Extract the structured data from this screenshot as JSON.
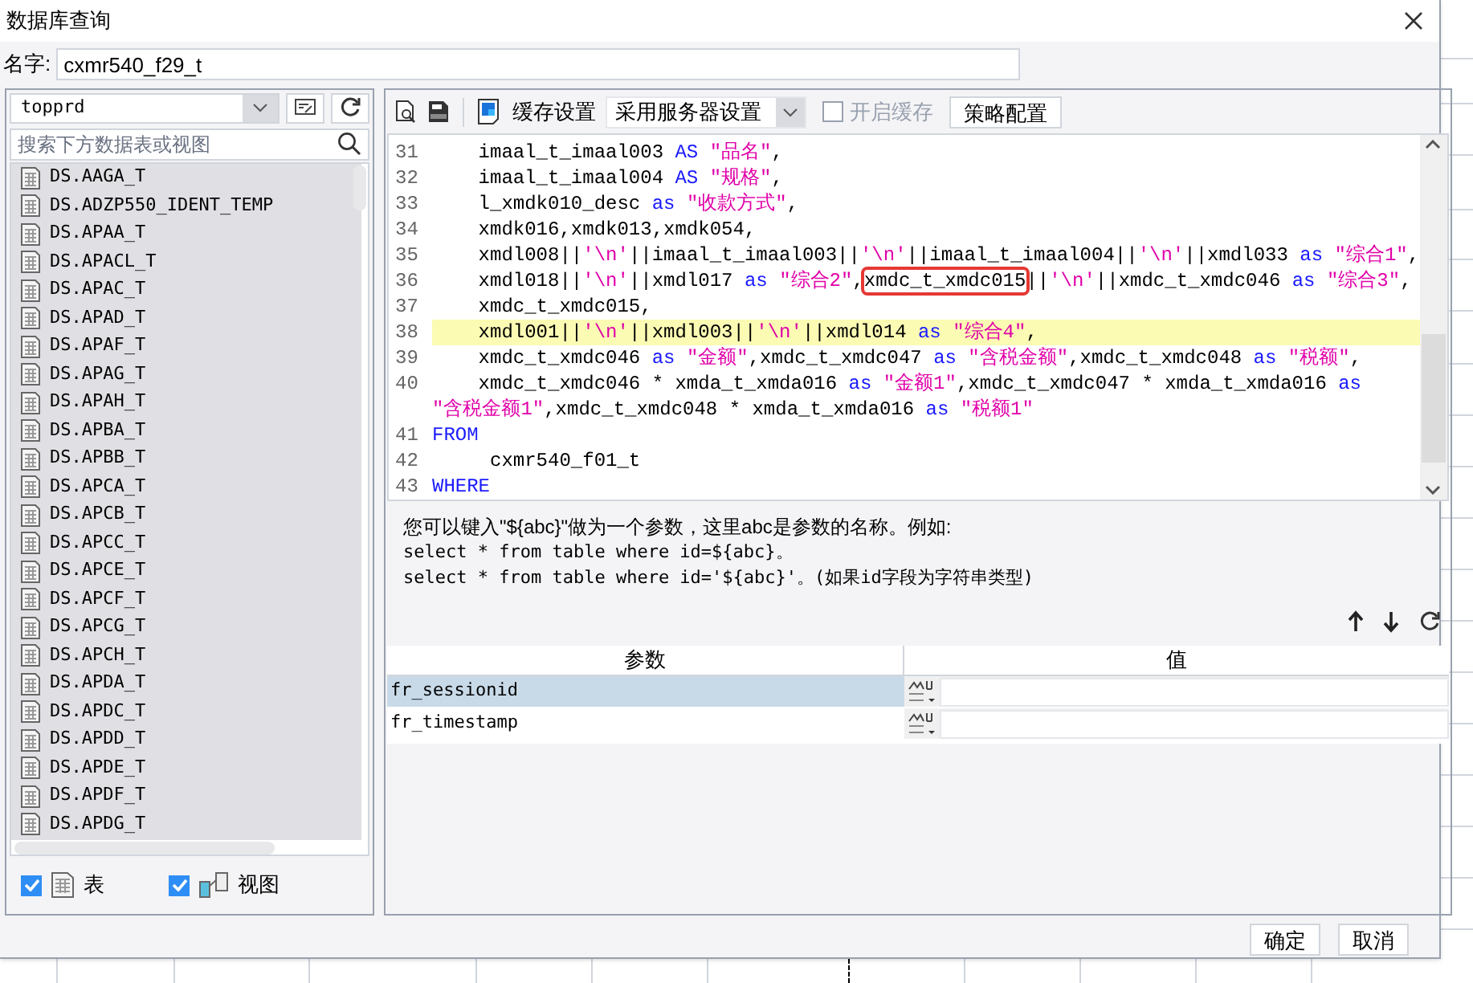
{
  "window": {
    "title": "数据库查询"
  },
  "name_field": {
    "label": "名字:",
    "value": "cxmr540_f29_t"
  },
  "left_panel": {
    "connection": "topprd",
    "search": {
      "placeholder": "搜索下方数据表或视图"
    },
    "tables": [
      "DS.AAGA_T",
      "DS.ADZP550_IDENT_TEMP",
      "DS.APAA_T",
      "DS.APACL_T",
      "DS.APAC_T",
      "DS.APAD_T",
      "DS.APAF_T",
      "DS.APAG_T",
      "DS.APAH_T",
      "DS.APBA_T",
      "DS.APBB_T",
      "DS.APCA_T",
      "DS.APCB_T",
      "DS.APCC_T",
      "DS.APCE_T",
      "DS.APCF_T",
      "DS.APCG_T",
      "DS.APCH_T",
      "DS.APDA_T",
      "DS.APDC_T",
      "DS.APDD_T",
      "DS.APDE_T",
      "DS.APDF_T",
      "DS.APDG_T"
    ],
    "filters": [
      {
        "kind": "table",
        "label": "表",
        "checked": true
      },
      {
        "kind": "view",
        "label": "视图",
        "checked": true
      }
    ]
  },
  "toolbar": {
    "cache_label": "缓存设置",
    "cache_mode": "采用服务器设置",
    "enable_cache": {
      "label": "开启缓存",
      "checked": false,
      "disabled": true
    },
    "strategy_button": "策略配置"
  },
  "editor": {
    "lines": [
      {
        "number": "31",
        "current": false,
        "tokens": [
          {
            "kind": "plain",
            "text": "    imaal_t_imaal003 "
          },
          {
            "kind": "keyword",
            "text": "AS "
          },
          {
            "kind": "string",
            "text": "\"品名\""
          },
          {
            "kind": "plain",
            "text": ","
          }
        ]
      },
      {
        "number": "32",
        "current": false,
        "tokens": [
          {
            "kind": "plain",
            "text": "    imaal_t_imaal004 "
          },
          {
            "kind": "keyword",
            "text": "AS "
          },
          {
            "kind": "string",
            "text": "\"规格\""
          },
          {
            "kind": "plain",
            "text": ","
          }
        ]
      },
      {
        "number": "33",
        "current": false,
        "tokens": [
          {
            "kind": "plain",
            "text": "    l_xmdk010_desc "
          },
          {
            "kind": "keyword",
            "text": "as "
          },
          {
            "kind": "string",
            "text": "\"收款方式\""
          },
          {
            "kind": "plain",
            "text": ","
          }
        ]
      },
      {
        "number": "34",
        "current": false,
        "tokens": [
          {
            "kind": "plain",
            "text": "    xmdk016,xmdk013,xmdk054,"
          }
        ]
      },
      {
        "number": "35",
        "current": false,
        "tokens": [
          {
            "kind": "plain",
            "text": "    xmdl008||"
          },
          {
            "kind": "string",
            "text": "'\\n'"
          },
          {
            "kind": "plain",
            "text": "||imaal_t_imaal003||"
          },
          {
            "kind": "string",
            "text": "'\\n'"
          },
          {
            "kind": "plain",
            "text": "||imaal_t_imaal004||"
          },
          {
            "kind": "string",
            "text": "'\\n'"
          },
          {
            "kind": "plain",
            "text": "||xmdl033 "
          },
          {
            "kind": "keyword",
            "text": "as "
          },
          {
            "kind": "string",
            "text": "\"综合1\""
          },
          {
            "kind": "plain",
            "text": ","
          }
        ]
      },
      {
        "number": "36",
        "current": false,
        "tokens": [
          {
            "kind": "plain",
            "text": "    xmdl018||"
          },
          {
            "kind": "string",
            "text": "'\\n'"
          },
          {
            "kind": "plain",
            "text": "||xmdl017 "
          },
          {
            "kind": "keyword",
            "text": "as "
          },
          {
            "kind": "string",
            "text": "\"综合2\""
          },
          {
            "kind": "plain",
            "text": ","
          },
          {
            "kind": "boxed",
            "text": "xmdc_t_xmdc015"
          },
          {
            "kind": "plain",
            "text": "||"
          },
          {
            "kind": "string",
            "text": "'\\n'"
          },
          {
            "kind": "plain",
            "text": "||xmdc_t_xmdc046 "
          },
          {
            "kind": "keyword",
            "text": "as "
          },
          {
            "kind": "string",
            "text": "\"综合3\""
          },
          {
            "kind": "plain",
            "text": ","
          }
        ]
      },
      {
        "number": "37",
        "current": false,
        "tokens": [
          {
            "kind": "plain",
            "text": "    xmdc_t_xmdc015,"
          }
        ]
      },
      {
        "number": "38",
        "current": true,
        "tokens": [
          {
            "kind": "plain",
            "text": "    xmdl001||"
          },
          {
            "kind": "string",
            "text": "'\\n'"
          },
          {
            "kind": "plain",
            "text": "||xmdl003||"
          },
          {
            "kind": "string",
            "text": "'\\n'"
          },
          {
            "kind": "plain",
            "text": "||xmdl014 "
          },
          {
            "kind": "keyword",
            "text": "as "
          },
          {
            "kind": "string",
            "text": "\"综合4\""
          },
          {
            "kind": "plain",
            "text": ","
          }
        ]
      },
      {
        "number": "39",
        "current": false,
        "tokens": [
          {
            "kind": "plain",
            "text": "    xmdc_t_xmdc046 "
          },
          {
            "kind": "keyword",
            "text": "as "
          },
          {
            "kind": "string",
            "text": "\"金额\""
          },
          {
            "kind": "plain",
            "text": ",xmdc_t_xmdc047 "
          },
          {
            "kind": "keyword",
            "text": "as "
          },
          {
            "kind": "string",
            "text": "\"含税金额\""
          },
          {
            "kind": "plain",
            "text": ",xmdc_t_xmdc048 "
          },
          {
            "kind": "keyword",
            "text": "as "
          },
          {
            "kind": "string",
            "text": "\"税额\""
          },
          {
            "kind": "plain",
            "text": ","
          }
        ]
      },
      {
        "number": "40",
        "current": false,
        "tokens": [
          {
            "kind": "plain",
            "text": "    xmdc_t_xmdc046 * xmda_t_xmda016 "
          },
          {
            "kind": "keyword",
            "text": "as "
          },
          {
            "kind": "string",
            "text": "\"金额1\""
          },
          {
            "kind": "plain",
            "text": ",xmdc_t_xmdc047 * xmda_t_xmda016 "
          },
          {
            "kind": "keyword",
            "text": "as"
          }
        ]
      },
      {
        "current": false,
        "tokens": [
          {
            "kind": "string",
            "text": "\"含税金额1\""
          },
          {
            "kind": "plain",
            "text": ",xmdc_t_xmdc048 * xmda_t_xmda016 "
          },
          {
            "kind": "keyword",
            "text": "as "
          },
          {
            "kind": "string",
            "text": "\"税额1\""
          }
        ]
      },
      {
        "number": "41",
        "current": false,
        "tokens": [
          {
            "kind": "keyword",
            "text": "FROM"
          }
        ]
      },
      {
        "number": "42",
        "current": false,
        "tokens": [
          {
            "kind": "plain",
            "text": "     cxmr540_f01_t"
          }
        ]
      },
      {
        "number": "43",
        "current": false,
        "tokens": [
          {
            "kind": "keyword",
            "text": "WHERE"
          }
        ]
      }
    ]
  },
  "hint": [
    "您可以键入\"${abc}\"做为一个参数，这里abc是参数的名称。例如:",
    "select * from table where id=${abc}。",
    "select * from table where id='${abc}'。(如果id字段为字符串类型)"
  ],
  "parameters": {
    "columns": [
      "参数",
      "值"
    ],
    "rows": [
      {
        "name": "fr_sessionid",
        "selected": true
      },
      {
        "name": "fr_timestamp",
        "selected": false
      }
    ]
  },
  "buttons": [
    "确定",
    "取消"
  ]
}
